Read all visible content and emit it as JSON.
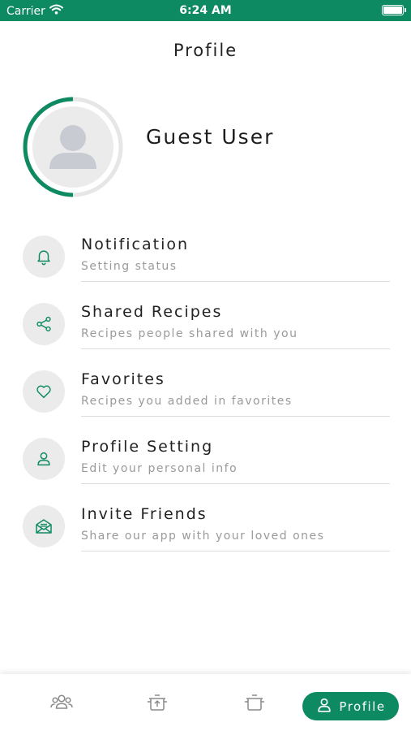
{
  "status_bar": {
    "carrier": "Carrier",
    "time": "6:24 AM"
  },
  "header": {
    "title": "Profile"
  },
  "profile": {
    "name": "Guest User",
    "progress_ring_fraction": 0.5
  },
  "menu": [
    {
      "title": "Notification",
      "subtitle": "Setting status",
      "icon": "bell-icon"
    },
    {
      "title": "Shared Recipes",
      "subtitle": "Recipes people shared with you",
      "icon": "share-icon"
    },
    {
      "title": "Favorites",
      "subtitle": "Recipes you added in favorites",
      "icon": "heart-icon"
    },
    {
      "title": "Profile Setting",
      "subtitle": "Edit your personal info",
      "icon": "user-icon"
    },
    {
      "title": "Invite Friends",
      "subtitle": "Share our app with your loved ones",
      "icon": "mail-icon"
    }
  ],
  "tab_bar": {
    "tabs": [
      {
        "icon": "community-icon"
      },
      {
        "icon": "add-recipe-pot-icon"
      },
      {
        "icon": "cooking-pot-icon"
      },
      {
        "icon": "profile-icon",
        "label": "Profile",
        "active": true
      }
    ]
  },
  "colors": {
    "accent": "#0e8a63",
    "icon_bg": "#ebebeb",
    "subtitle_text": "#9a9a9a",
    "divider": "#dcdcdc"
  }
}
